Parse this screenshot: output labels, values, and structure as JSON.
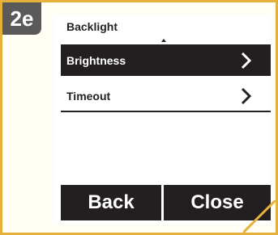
{
  "step": {
    "label": "2e"
  },
  "screen": {
    "title": "Backlight",
    "menu": [
      {
        "label": "Brightness",
        "selected": true
      },
      {
        "label": "Timeout",
        "selected": false
      }
    ],
    "buttons": {
      "back": "Back",
      "close": "Close"
    }
  },
  "colors": {
    "frame_border": "#e5b13b",
    "frame_fill": "#fffdf4",
    "badge": "#5a5a5a",
    "selection": "#231f20"
  },
  "icons": {
    "scroll": "scroll-up-indicator-icon",
    "item": "chevron-right-icon"
  }
}
